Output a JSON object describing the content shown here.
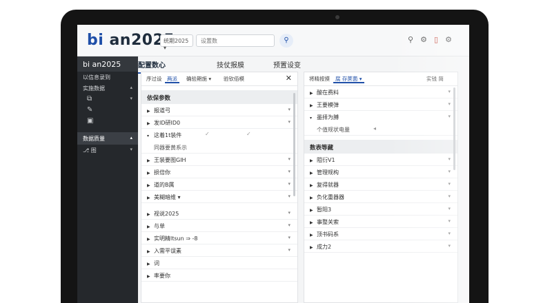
{
  "app": {
    "logo_prefix": "bi",
    "logo_rest": " an2025"
  },
  "topbar": {
    "year_select": "统期2025 ▾",
    "search_placeholder": "设置数",
    "search_icon": "search-icon"
  },
  "sidebar": {
    "title": "bi an2025",
    "items": [
      {
        "label": "以信息录到"
      },
      {
        "label": "实施数据",
        "chev": "▴"
      }
    ],
    "icons": [
      "⧉",
      "✎",
      "▣"
    ],
    "section": {
      "label": "数据质量",
      "chev": "▴"
    },
    "section_item": {
      "label": "⎇ 图",
      "chev": "▾"
    }
  },
  "main_tabs": [
    "配置数心",
    "技仗报膜",
    "预置设变"
  ],
  "left_panel": {
    "chips": [
      "序过设",
      "两派",
      "确验期施 ▾",
      "验钦佰模"
    ],
    "section_title": "依保参数",
    "rows": [
      {
        "label": "报道弓",
        "chev": "▾"
      },
      {
        "label": "发ID研ID0",
        "chev": "▾"
      },
      {
        "label": "这着1t装件",
        "sub": false
      },
      {
        "label": "同器要黄系示",
        "sub": true
      },
      {
        "label": "王装要图GIH",
        "chev": "▾"
      },
      {
        "label": "损倍你",
        "chev": "▾"
      },
      {
        "label": "道的B属",
        "chev": "▾"
      },
      {
        "label": "美糊暗维 ▾",
        "chev": "▾"
      },
      {
        "label": "视说2025",
        "chev": "▾"
      },
      {
        "label": "与单",
        "chev": "▾"
      },
      {
        "label": "实明精ltsun ⇒ -8",
        "chev": "▾"
      },
      {
        "label": "入需平误素",
        "chev": "▾"
      },
      {
        "label": "词",
        "chev": ""
      },
      {
        "label": "率要你",
        "chev": ""
      }
    ]
  },
  "right_panel": {
    "chips": [
      "将精按摸",
      "腐 存蔗菌 ▾"
    ],
    "right_chip": "实钱 简",
    "rows_top": [
      {
        "label": "酸在费料",
        "chev": "▾"
      },
      {
        "label": "王要模弹",
        "chev": "▾"
      },
      {
        "label": "墨择为膊",
        "chev": "▾"
      },
      {
        "label": "个值规状电量",
        "chev": ""
      }
    ],
    "section_title": "数表等藏",
    "rows": [
      {
        "label": "阻衍V1",
        "chev": "▾"
      },
      {
        "label": "管理规构",
        "chev": "▾"
      },
      {
        "label": "复得就器",
        "chev": "▾"
      },
      {
        "label": "负化重器器",
        "chev": "▾"
      },
      {
        "label": "暂阳3",
        "chev": "▾"
      },
      {
        "label": "事整关索",
        "chev": "▾"
      },
      {
        "label": "顶书码系",
        "chev": "▾"
      },
      {
        "label": "成力2",
        "chev": "▾"
      }
    ]
  },
  "colors": {
    "accent": "#1f4fa8",
    "sidebar_bg": "#25282c"
  }
}
